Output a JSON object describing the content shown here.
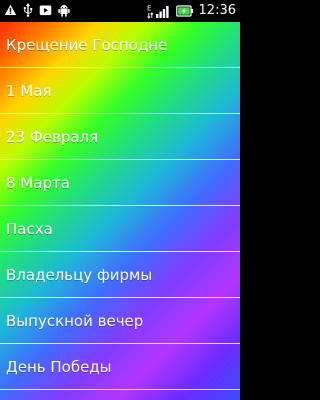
{
  "status_bar": {
    "time": "12:36",
    "icons": [
      "warning-icon",
      "usb-icon",
      "camera-icon",
      "android-icon",
      "signal-icon",
      "battery-icon"
    ]
  },
  "list": {
    "items": [
      "Крещение Господне",
      "1 Мая",
      "23 Февраля",
      "8 Марта",
      "Пасха",
      "Владельцу фирмы",
      "Выпускной вечер",
      "День Победы"
    ]
  }
}
